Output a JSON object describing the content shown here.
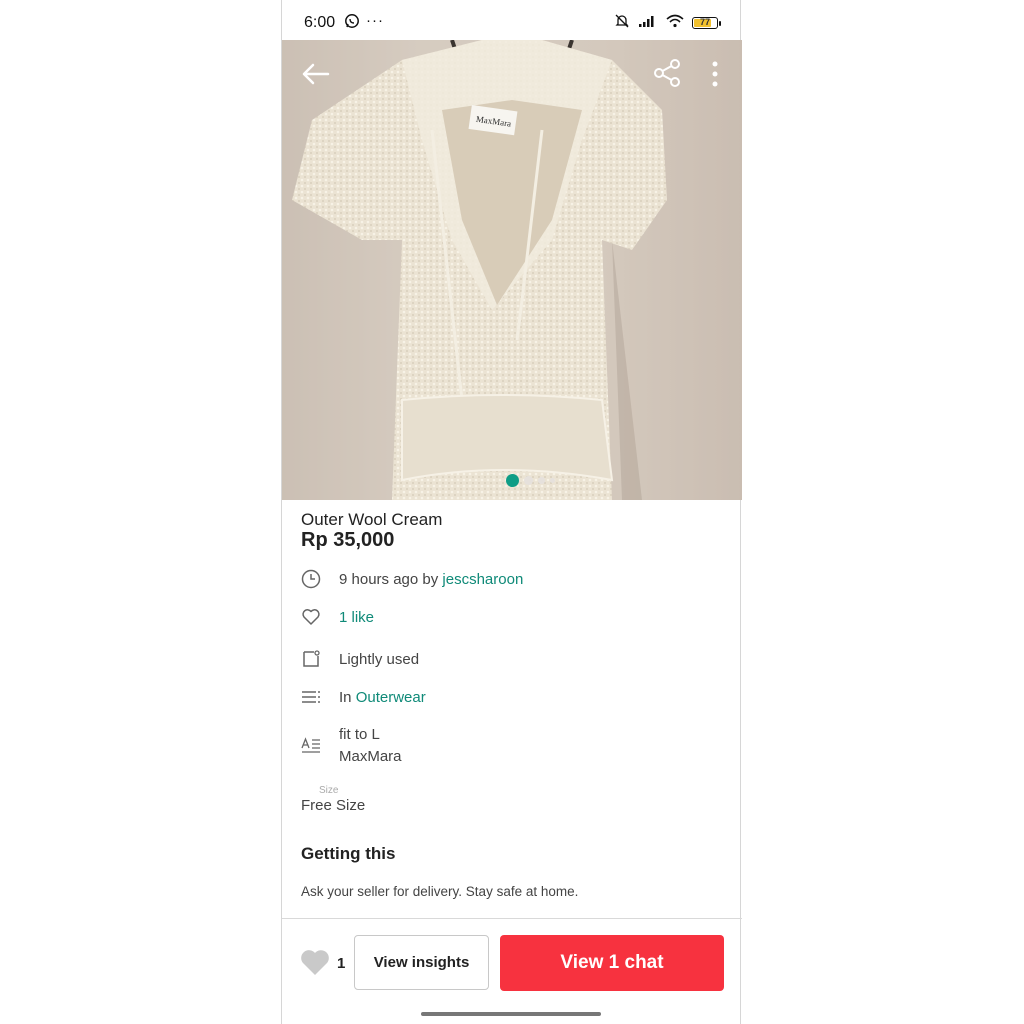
{
  "status_bar": {
    "time": "6:00",
    "more": "···",
    "battery": "77",
    "battery_color": "#f2c12e"
  },
  "gallery": {
    "dots_count": 4,
    "active_dot": 0,
    "active_color": "#0f9d86",
    "brand_label": "MaxMara"
  },
  "product": {
    "title": "Outer Wool Cream",
    "price": "Rp 35,000"
  },
  "meta": {
    "time_ago": "9 hours ago by ",
    "seller": "jescsharoon",
    "likes": "1 like",
    "condition": "Lightly used",
    "category_prefix": "In ",
    "category": "Outerwear",
    "description_line1": "fit to L",
    "description_line2": "MaxMara",
    "size_label": "Size",
    "size_value": "Free Size"
  },
  "getting": {
    "title": "Getting this",
    "body": "Ask your seller for delivery. Stay safe at home."
  },
  "bottom_bar": {
    "like_count": "1",
    "insights_label": "View insights",
    "chat_label": "View 1 chat",
    "chat_color": "#f7323f"
  },
  "accent_color": "#0f8a78"
}
